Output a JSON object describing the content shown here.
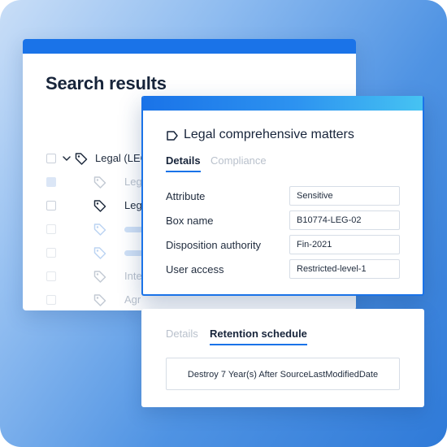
{
  "search": {
    "title": "Search results",
    "rows": [
      {
        "label": "Legal (LEG",
        "style": "parent"
      },
      {
        "label": "Leg",
        "style": "faded"
      },
      {
        "label": "Leg",
        "style": "normal"
      },
      {
        "label": "",
        "style": "placeholder"
      },
      {
        "label": "",
        "style": "placeholder"
      },
      {
        "label": "Inte",
        "style": "faded"
      },
      {
        "label": "Agr",
        "style": "faded"
      },
      {
        "label": "",
        "style": "placeholder"
      }
    ]
  },
  "details": {
    "title": "Legal comprehensive matters",
    "tabs": [
      {
        "label": "Details",
        "active": true
      },
      {
        "label": "Compliance",
        "active": false
      }
    ],
    "attributes": [
      {
        "label": "Attribute",
        "value": "Sensitive"
      },
      {
        "label": "Box name",
        "value": "B10774-LEG-02"
      },
      {
        "label": "Disposition authority",
        "value": "Fin-2021"
      },
      {
        "label": "User access",
        "value": "Restricted-level-1"
      }
    ]
  },
  "retention": {
    "tabs": [
      {
        "label": "Details",
        "active": false
      },
      {
        "label": "Retention schedule",
        "active": true
      }
    ],
    "rule": "Destroy 7 Year(s) After SourceLastModifiedDate"
  },
  "colors": {
    "accent": "#1a73e8",
    "accent_light": "#46c3f2",
    "text": "#17243a",
    "muted": "#b9c1cc"
  },
  "icons": {
    "row_expand": "chevron-down-icon",
    "row_item": "tag-icon",
    "details_header": "label-icon"
  }
}
